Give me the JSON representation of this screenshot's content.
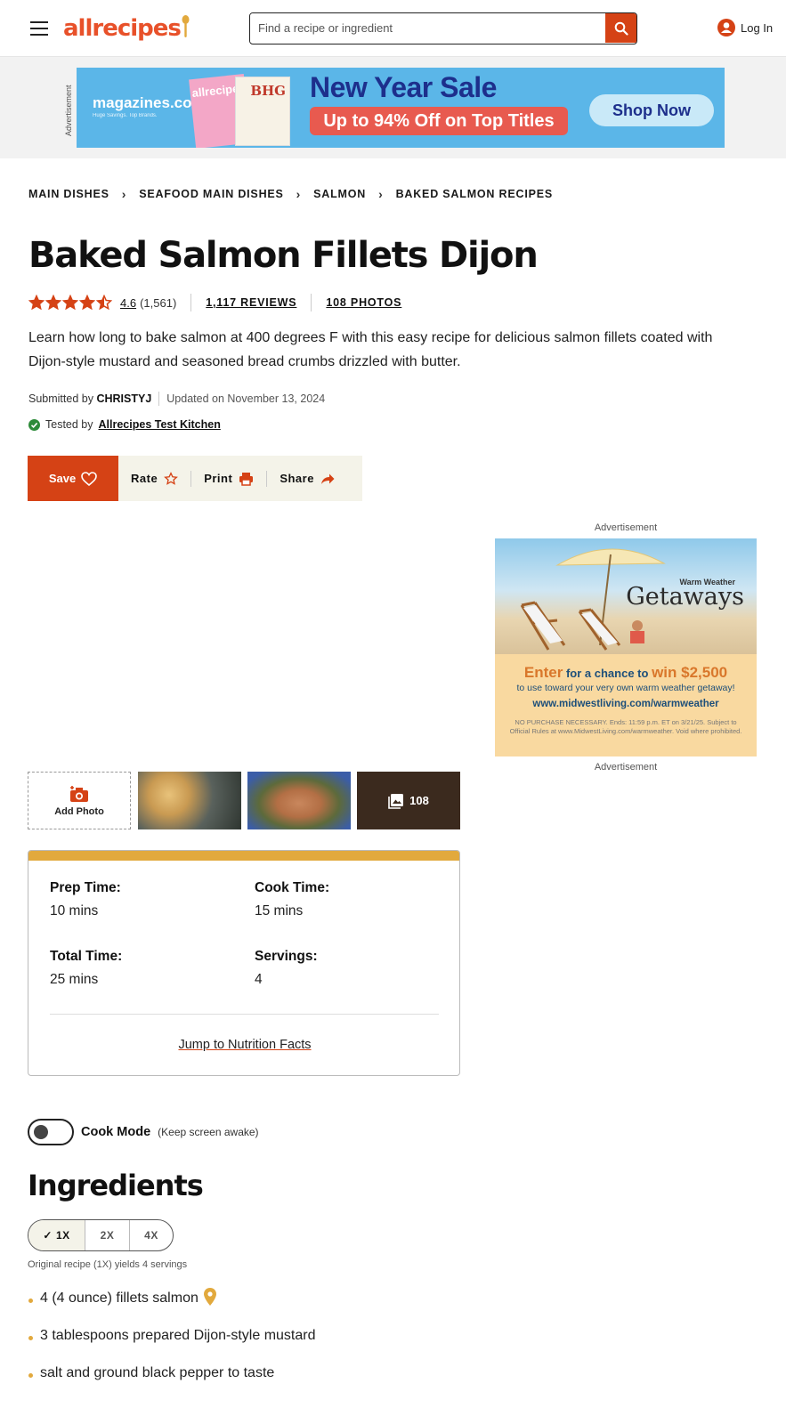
{
  "header": {
    "logo": "allrecipes",
    "search_placeholder": "Find a recipe or ingredient",
    "login_label": "Log In"
  },
  "top_ad": {
    "side_label": "Advertisement",
    "brand": "magazines",
    "brand_sub": ".com",
    "brand_tagline": "Huge Savings. Top Brands.",
    "cover1": "allrecipes",
    "cover2": "BHG",
    "headline": "New Year Sale",
    "subline": "Up to 94% Off on Top Titles",
    "cta": "Shop Now"
  },
  "breadcrumb": [
    "MAIN DISHES",
    "SEAFOOD MAIN DISHES",
    "SALMON",
    "BAKED SALMON RECIPES"
  ],
  "recipe": {
    "title": "Baked Salmon Fillets Dijon",
    "rating": "4.6",
    "rating_count": "(1,561)",
    "stars_filled": 4.5,
    "reviews": "1,117 REVIEWS",
    "photos": "108 PHOTOS",
    "description": "Learn how long to bake salmon at 400 degrees F with this easy recipe for delicious salmon fillets coated with Dijon-style mustard and seasoned bread crumbs drizzled with butter.",
    "submitted_prefix": "Submitted by",
    "author": "CHRISTYJ",
    "updated": "Updated on November 13, 2024",
    "tested_prefix": "Tested by",
    "tested_by": "Allrecipes Test Kitchen"
  },
  "actions": {
    "save": "Save",
    "rate": "Rate",
    "print": "Print",
    "share": "Share"
  },
  "side_ad": {
    "label_top": "Advertisement",
    "label_bottom": "Advertisement",
    "small_title": "Warm Weather",
    "title": "Getaways",
    "enter_a": "Enter",
    "enter_b": "for a chance to",
    "enter_c": "win $2,500",
    "line2": "to use toward your very own warm weather getaway!",
    "url": "www.midwestliving.com/warmweather",
    "fine": "NO PURCHASE NECESSARY. Ends: 11:59 p.m. ET on 3/21/25. Subject to Official Rules at www.MidwestLiving.com/warmweather. Void where prohibited."
  },
  "photo_strip": {
    "add_photo": "Add Photo",
    "more_count": "108"
  },
  "details": {
    "prep_label": "Prep Time:",
    "prep_value": "10 mins",
    "cook_label": "Cook Time:",
    "cook_value": "15 mins",
    "total_label": "Total Time:",
    "total_value": "25 mins",
    "servings_label": "Servings:",
    "servings_value": "4",
    "jump": "Jump to Nutrition Facts"
  },
  "cook_mode": {
    "label": "Cook Mode",
    "hint": "(Keep screen awake)"
  },
  "ingredients": {
    "heading": "Ingredients",
    "scales": [
      "1X",
      "2X",
      "4X"
    ],
    "selected_scale": "1X",
    "yields_note": "Original recipe (1X) yields 4 servings",
    "items": [
      "4 (4 ounce) fillets salmon",
      "3 tablespoons prepared Dijon-style mustard",
      "salt and ground black pepper to taste"
    ]
  },
  "colors": {
    "brand": "#e8512a",
    "accent": "#d54215",
    "gold": "#e2a93d",
    "action_bg": "#f4f3e9"
  }
}
